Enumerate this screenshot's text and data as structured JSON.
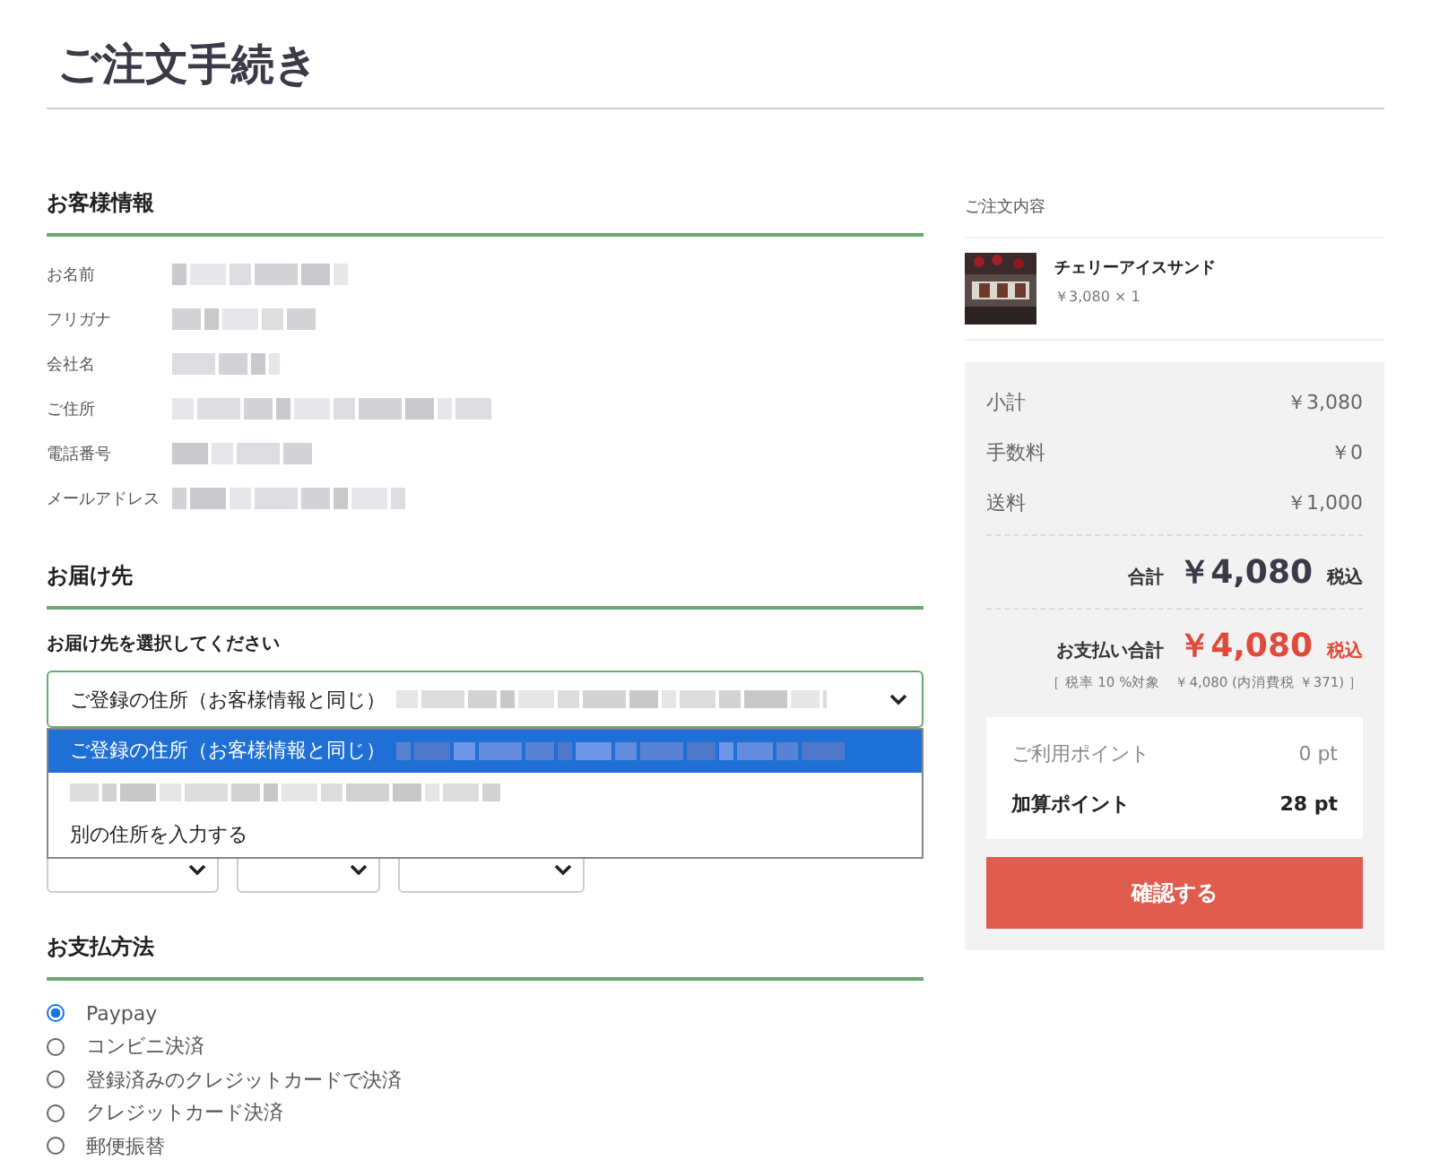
{
  "page_title": "ご注文手続き",
  "customer": {
    "heading": "お客様情報",
    "fields": [
      {
        "label": "お名前"
      },
      {
        "label": "フリガナ"
      },
      {
        "label": "会社名"
      },
      {
        "label": "ご住所"
      },
      {
        "label": "電話番号"
      },
      {
        "label": "メールアドレス"
      }
    ]
  },
  "delivery": {
    "heading": "お届け先",
    "prompt": "お届け先を選択してください",
    "select_value": "ご登録の住所（お客様情報と同じ）",
    "expanded": true,
    "options": [
      {
        "label": "ご登録の住所（お客様情報と同じ）",
        "selected": true
      },
      {
        "selected": false
      },
      {
        "label": "別の住所を入力する",
        "selected": false
      }
    ]
  },
  "payment": {
    "heading": "お支払方法",
    "methods": [
      {
        "label": "Paypay",
        "selected": true
      },
      {
        "label": "コンビニ決済",
        "selected": false
      },
      {
        "label": "登録済みのクレジットカードで決済",
        "selected": false
      },
      {
        "label": "クレジットカード決済",
        "selected": false
      },
      {
        "label": "郵便振替",
        "selected": false
      }
    ]
  },
  "order": {
    "heading": "ご注文内容",
    "items": [
      {
        "name": "チェリーアイスサンド",
        "price": "￥3,080 × 1",
        "kind": "picture"
      }
    ]
  },
  "summary": {
    "rows": [
      {
        "label": "小計",
        "value": "￥3,080"
      },
      {
        "label": "手数料",
        "value": "￥0"
      },
      {
        "label": "送料",
        "value": "￥1,000"
      }
    ],
    "total_label": "合計",
    "total": "￥4,080",
    "total_tax": "税込",
    "pay_label": "お支払い合計",
    "pay_total": "￥4,080",
    "pay_tax": "税込",
    "tax_note": "［ 税率 10 %対象　￥4,080 (内消費税 ￥371) ］",
    "points": [
      {
        "label": "ご利用ポイント",
        "value": "0 pt",
        "kind": "plain"
      },
      {
        "label": "加算ポイント",
        "value": "28 pt",
        "kind": "bold"
      }
    ],
    "confirm_button": "確認する"
  }
}
